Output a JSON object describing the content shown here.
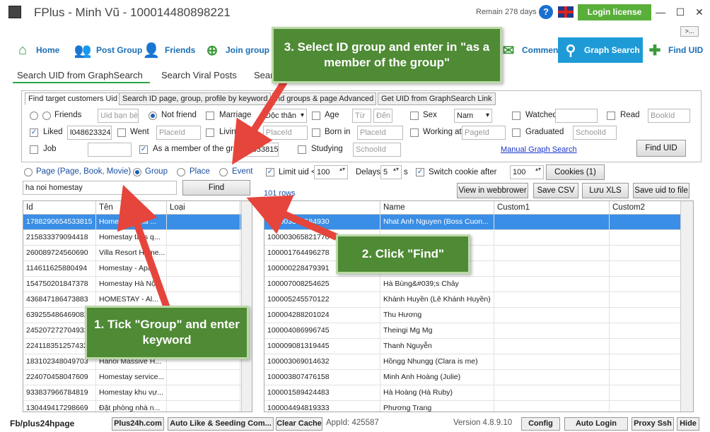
{
  "title": {
    "app_name": "FPlus - Minh Vũ - 100014480898221",
    "remain": "Remain 278 days",
    "help": "?",
    "login": "Login license",
    "more": ">..."
  },
  "nav": [
    {
      "label": "Home",
      "icon": "home-icon"
    },
    {
      "label": "Post Group",
      "icon": "people-icon"
    },
    {
      "label": "Friends",
      "icon": "friends-icon"
    },
    {
      "label": "Join group",
      "icon": "join-group-icon"
    },
    {
      "label": "Comment",
      "icon": "comment-icon"
    },
    {
      "label": "Graph Search",
      "icon": "search-icon"
    },
    {
      "label": "Find UID",
      "icon": "add-user-icon"
    }
  ],
  "subtabs": [
    "Search UID from GraphSearch",
    "Search Viral Posts",
    "Sear"
  ],
  "inner_tabs": [
    "Find target customers Uid",
    "Search ID page, group, profile by keyword",
    "nd groups & page Advanced",
    "Get UID from GraphSearch Link"
  ],
  "filters": {
    "friends": "Friends",
    "friends_placeholder": "Uid bạn bè",
    "not_friend": "Not friend",
    "marriage": "Marriage",
    "marriage_value": "Độc thân",
    "age": "Age",
    "age_from": "Từ",
    "age_to": "Đến",
    "sex": "Sex",
    "sex_value": "Nam",
    "watched": "Watched",
    "read": "Read",
    "read_placeholder": "BookId",
    "liked": "Liked",
    "liked_value": "l048623324",
    "went": "Went",
    "went_placeholder": "PlaceId",
    "living": "Living",
    "living_placeholder": "PlaceId",
    "born": "Born in",
    "born_placeholder": "PlaceId",
    "working": "Working at",
    "working_placeholder": "PageId",
    "graduated": "Graduated",
    "graduated_placeholder": "SchoolId",
    "job": "Job",
    "member": "As a member of the group",
    "member_value": "l654533815",
    "studying": "Studying",
    "studying_placeholder": "SchoolId",
    "manual_link": "Manual Graph Search",
    "find_uid": "Find UID"
  },
  "options": {
    "page": "Page (Page, Book, Movie)",
    "group": "Group",
    "place": "Place",
    "event": "Event",
    "limit_label": "Limit uid <",
    "limit_value": "100",
    "delays_label": "Delays",
    "delays_value": "5",
    "delays_unit": "s",
    "switch_label": "Switch cookie after",
    "switch_value": "100",
    "cookies": "Cookies (1)"
  },
  "search": {
    "keyword": "ha noi homestay",
    "find": "Find",
    "rows": "101 rows"
  },
  "actions": [
    "View in webbrower",
    "Save CSV",
    "Lưu XLS",
    "Save uid to file"
  ],
  "left_grid": {
    "headers": [
      "Id",
      "Tên",
      "Loại"
    ],
    "rows": [
      [
        "1788290654533815",
        "Homestay    Nhà ..."
      ],
      [
        "215833379094418",
        "Homestay tất's q..."
      ],
      [
        "260089724560690",
        "Villa Resort Home..."
      ],
      [
        "114611625880494",
        "Homestay - Apa..."
      ],
      [
        "154750201847378",
        "Homestay Hà Nội..."
      ],
      [
        "436847186473883",
        "HOMESTAY - Al..."
      ],
      [
        "639255486469082",
        ""
      ],
      [
        "245207272704932",
        ""
      ],
      [
        "224118351257432",
        ""
      ],
      [
        "183102348049703",
        "Hanoi Massive H..."
      ],
      [
        "224070458047609",
        "Homestay service..."
      ],
      [
        "933837966784819",
        "Homestay khu vự..."
      ],
      [
        "130449417298669",
        "Đặt phòng nhà n..."
      ]
    ]
  },
  "right_grid": {
    "headers": [
      "Id",
      "Name",
      "Custom1",
      "Custom2"
    ],
    "rows": [
      [
        "100003300584930",
        "Nhat Anh Nguyen (Boss Cuon..."
      ],
      [
        "100003065821770",
        ""
      ],
      [
        "100001764496278",
        "Bò)"
      ],
      [
        "100000228479391",
        ""
      ],
      [
        "100007008254625",
        "Hà Bùng&#039;s Chảy"
      ],
      [
        "100005245570122",
        "Khánh Huyền (Lê Khánh Huyền)"
      ],
      [
        "100004288201024",
        "Thu Hương"
      ],
      [
        "100004086996745",
        "Theingi Mg Mg"
      ],
      [
        "100009081319445",
        "Thanh Nguyễn"
      ],
      [
        "100003069014632",
        "Hồngg Nhungg (Clara is me)"
      ],
      [
        "100003807476158",
        "Minh Anh Hoàng (Julie)"
      ],
      [
        "100001589424483",
        "Hà Hoàng (Hà Ruby)"
      ],
      [
        "100004494819333",
        "Phương Trang"
      ]
    ]
  },
  "status": {
    "fb": "Fb/plus24hpage",
    "b1": "Plus24h.com",
    "b2": "Auto Like & Seeding Com...",
    "b3": "Clear Cache",
    "appid": "AppId: 425587",
    "version": "Version 4.8.9.10",
    "b4": "Config",
    "b5": "Auto Login",
    "b6": "Proxy Ssh",
    "b7": "Hide"
  },
  "callouts": {
    "c1": "1. Tick \"Group\" and enter keyword",
    "c2": "2. Click \"Find\"",
    "c3": "3. Select ID group and enter in \"as a member of the group\""
  },
  "colors": {
    "callout": "#4f8a35",
    "arrow": "#e6453c",
    "accent": "#1e9bd7",
    "login": "#5aaf3a"
  }
}
